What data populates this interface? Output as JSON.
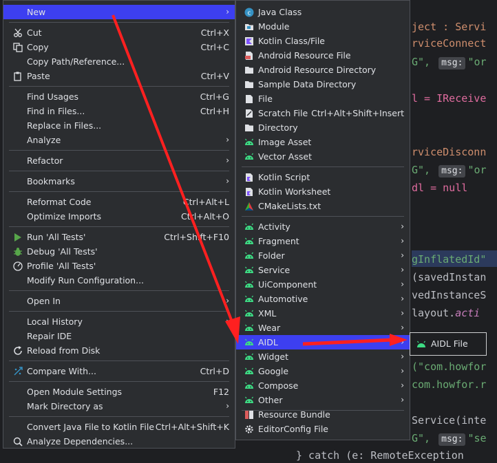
{
  "code": [
    {
      "text": "ject : Servi"
    },
    {
      "text": "rviceConnect"
    },
    {
      "pre": "G\", ",
      "tag": "msg:",
      "post": "\"or"
    },
    {
      "text": "l = IReceive"
    },
    {
      "text": "rviceDisconn"
    },
    {
      "pre": "G\", ",
      "tag": "msg:",
      "post": "\"or"
    },
    {
      "text": "dl = null"
    },
    {
      "text": "gInflatedId\""
    },
    {
      "text": "(savedInstan"
    },
    {
      "text": "vedInstanceS"
    },
    {
      "pre": "layout.",
      "post": "acti"
    },
    {
      "text": "(\"com.howfor"
    },
    {
      "text": "com.howfor.r"
    },
    {
      "text": "Service(inte"
    },
    {
      "pre": "G\", ",
      "tag": "msg:",
      "post": "\"se"
    },
    {
      "text": "} catch (e: RemoteException"
    }
  ],
  "main_menu": [
    {
      "label": "New",
      "arrow": "›",
      "selected": true
    },
    {
      "label": "Cut",
      "shortcut": "Ctrl+X",
      "icon": "scissors-icon"
    },
    {
      "label": "Copy",
      "shortcut": "Ctrl+C",
      "icon": "copy-icon"
    },
    {
      "label": "Copy Path/Reference..."
    },
    {
      "label": "Paste",
      "shortcut": "Ctrl+V",
      "icon": "paste-icon"
    },
    {
      "label": "Find Usages",
      "shortcut": "Ctrl+G"
    },
    {
      "label": "Find in Files...",
      "shortcut": "Ctrl+H"
    },
    {
      "label": "Replace in Files..."
    },
    {
      "label": "Analyze",
      "arrow": "›"
    },
    {
      "label": "Refactor",
      "arrow": "›"
    },
    {
      "label": "Bookmarks",
      "arrow": "›"
    },
    {
      "label": "Reformat Code",
      "shortcut": "Ctrl+Alt+L"
    },
    {
      "label": "Optimize Imports",
      "shortcut": "Ctrl+Alt+O"
    },
    {
      "label": "Run 'All Tests'",
      "shortcut": "Ctrl+Shift+F10",
      "icon": "run-icon"
    },
    {
      "label": "Debug 'All Tests'",
      "icon": "debug-icon"
    },
    {
      "label": "Profile 'All Tests'",
      "icon": "profile-icon"
    },
    {
      "label": "Modify Run Configuration..."
    },
    {
      "label": "Open In",
      "arrow": "›"
    },
    {
      "label": "Local History",
      "arrow": "›"
    },
    {
      "label": "Repair IDE"
    },
    {
      "label": "Reload from Disk",
      "icon": "reload-icon"
    },
    {
      "label": "Compare With...",
      "shortcut": "Ctrl+D",
      "icon": "compare-icon"
    },
    {
      "label": "Open Module Settings",
      "shortcut": "F12"
    },
    {
      "label": "Mark Directory as",
      "arrow": "›"
    },
    {
      "label": "Convert Java File to Kotlin File",
      "shortcut": "Ctrl+Alt+Shift+K"
    },
    {
      "label": "Analyze Dependencies...",
      "icon": "dependencies-icon"
    }
  ],
  "new_menu": [
    {
      "label": "Java Class",
      "icon": "java-class-icon"
    },
    {
      "label": "Module",
      "icon": "module-icon"
    },
    {
      "label": "Kotlin Class/File",
      "icon": "kotlin-icon"
    },
    {
      "label": "Android Resource File",
      "icon": "resource-file-icon"
    },
    {
      "label": "Android Resource Directory",
      "icon": "folder-icon"
    },
    {
      "label": "Sample Data Directory",
      "icon": "folder-icon"
    },
    {
      "label": "File",
      "icon": "file-icon"
    },
    {
      "label": "Scratch File",
      "shortcut": "Ctrl+Alt+Shift+Insert",
      "icon": "scratch-file-icon"
    },
    {
      "label": "Directory",
      "icon": "folder-icon"
    },
    {
      "label": "Image Asset",
      "icon": "android-icon"
    },
    {
      "label": "Vector Asset",
      "icon": "android-icon"
    },
    {
      "label": "Kotlin Script",
      "icon": "kotlin-script-icon"
    },
    {
      "label": "Kotlin Worksheet",
      "icon": "kotlin-worksheet-icon"
    },
    {
      "label": "CMakeLists.txt",
      "icon": "cmake-icon"
    },
    {
      "label": "Activity",
      "arrow": "›",
      "icon": "android-icon"
    },
    {
      "label": "Fragment",
      "arrow": "›",
      "icon": "android-icon"
    },
    {
      "label": "Folder",
      "arrow": "›",
      "icon": "android-icon"
    },
    {
      "label": "Service",
      "arrow": "›",
      "icon": "android-icon"
    },
    {
      "label": "UiComponent",
      "arrow": "›",
      "icon": "android-icon"
    },
    {
      "label": "Automotive",
      "arrow": "›",
      "icon": "android-icon"
    },
    {
      "label": "XML",
      "arrow": "›",
      "icon": "android-icon"
    },
    {
      "label": "Wear",
      "arrow": "›",
      "icon": "android-icon"
    },
    {
      "label": "AIDL",
      "arrow": "›",
      "icon": "android-icon",
      "selected": true
    },
    {
      "label": "Widget",
      "arrow": "›",
      "icon": "android-icon"
    },
    {
      "label": "Google",
      "arrow": "›",
      "icon": "android-icon"
    },
    {
      "label": "Compose",
      "arrow": "›",
      "icon": "android-icon"
    },
    {
      "label": "Other",
      "arrow": "›",
      "icon": "android-icon"
    },
    {
      "label": "Resource Bundle",
      "icon": "resource-bundle-icon"
    },
    {
      "label": "EditorConfig File",
      "icon": "gear-icon"
    }
  ],
  "aidl_submenu": {
    "label": "AIDL File",
    "icon": "android-icon"
  },
  "colors": {
    "selection": "#3d3ff0",
    "menu_bg": "#2b2d30",
    "arrow": "#ff2020",
    "android_green": "#3ddc84"
  }
}
